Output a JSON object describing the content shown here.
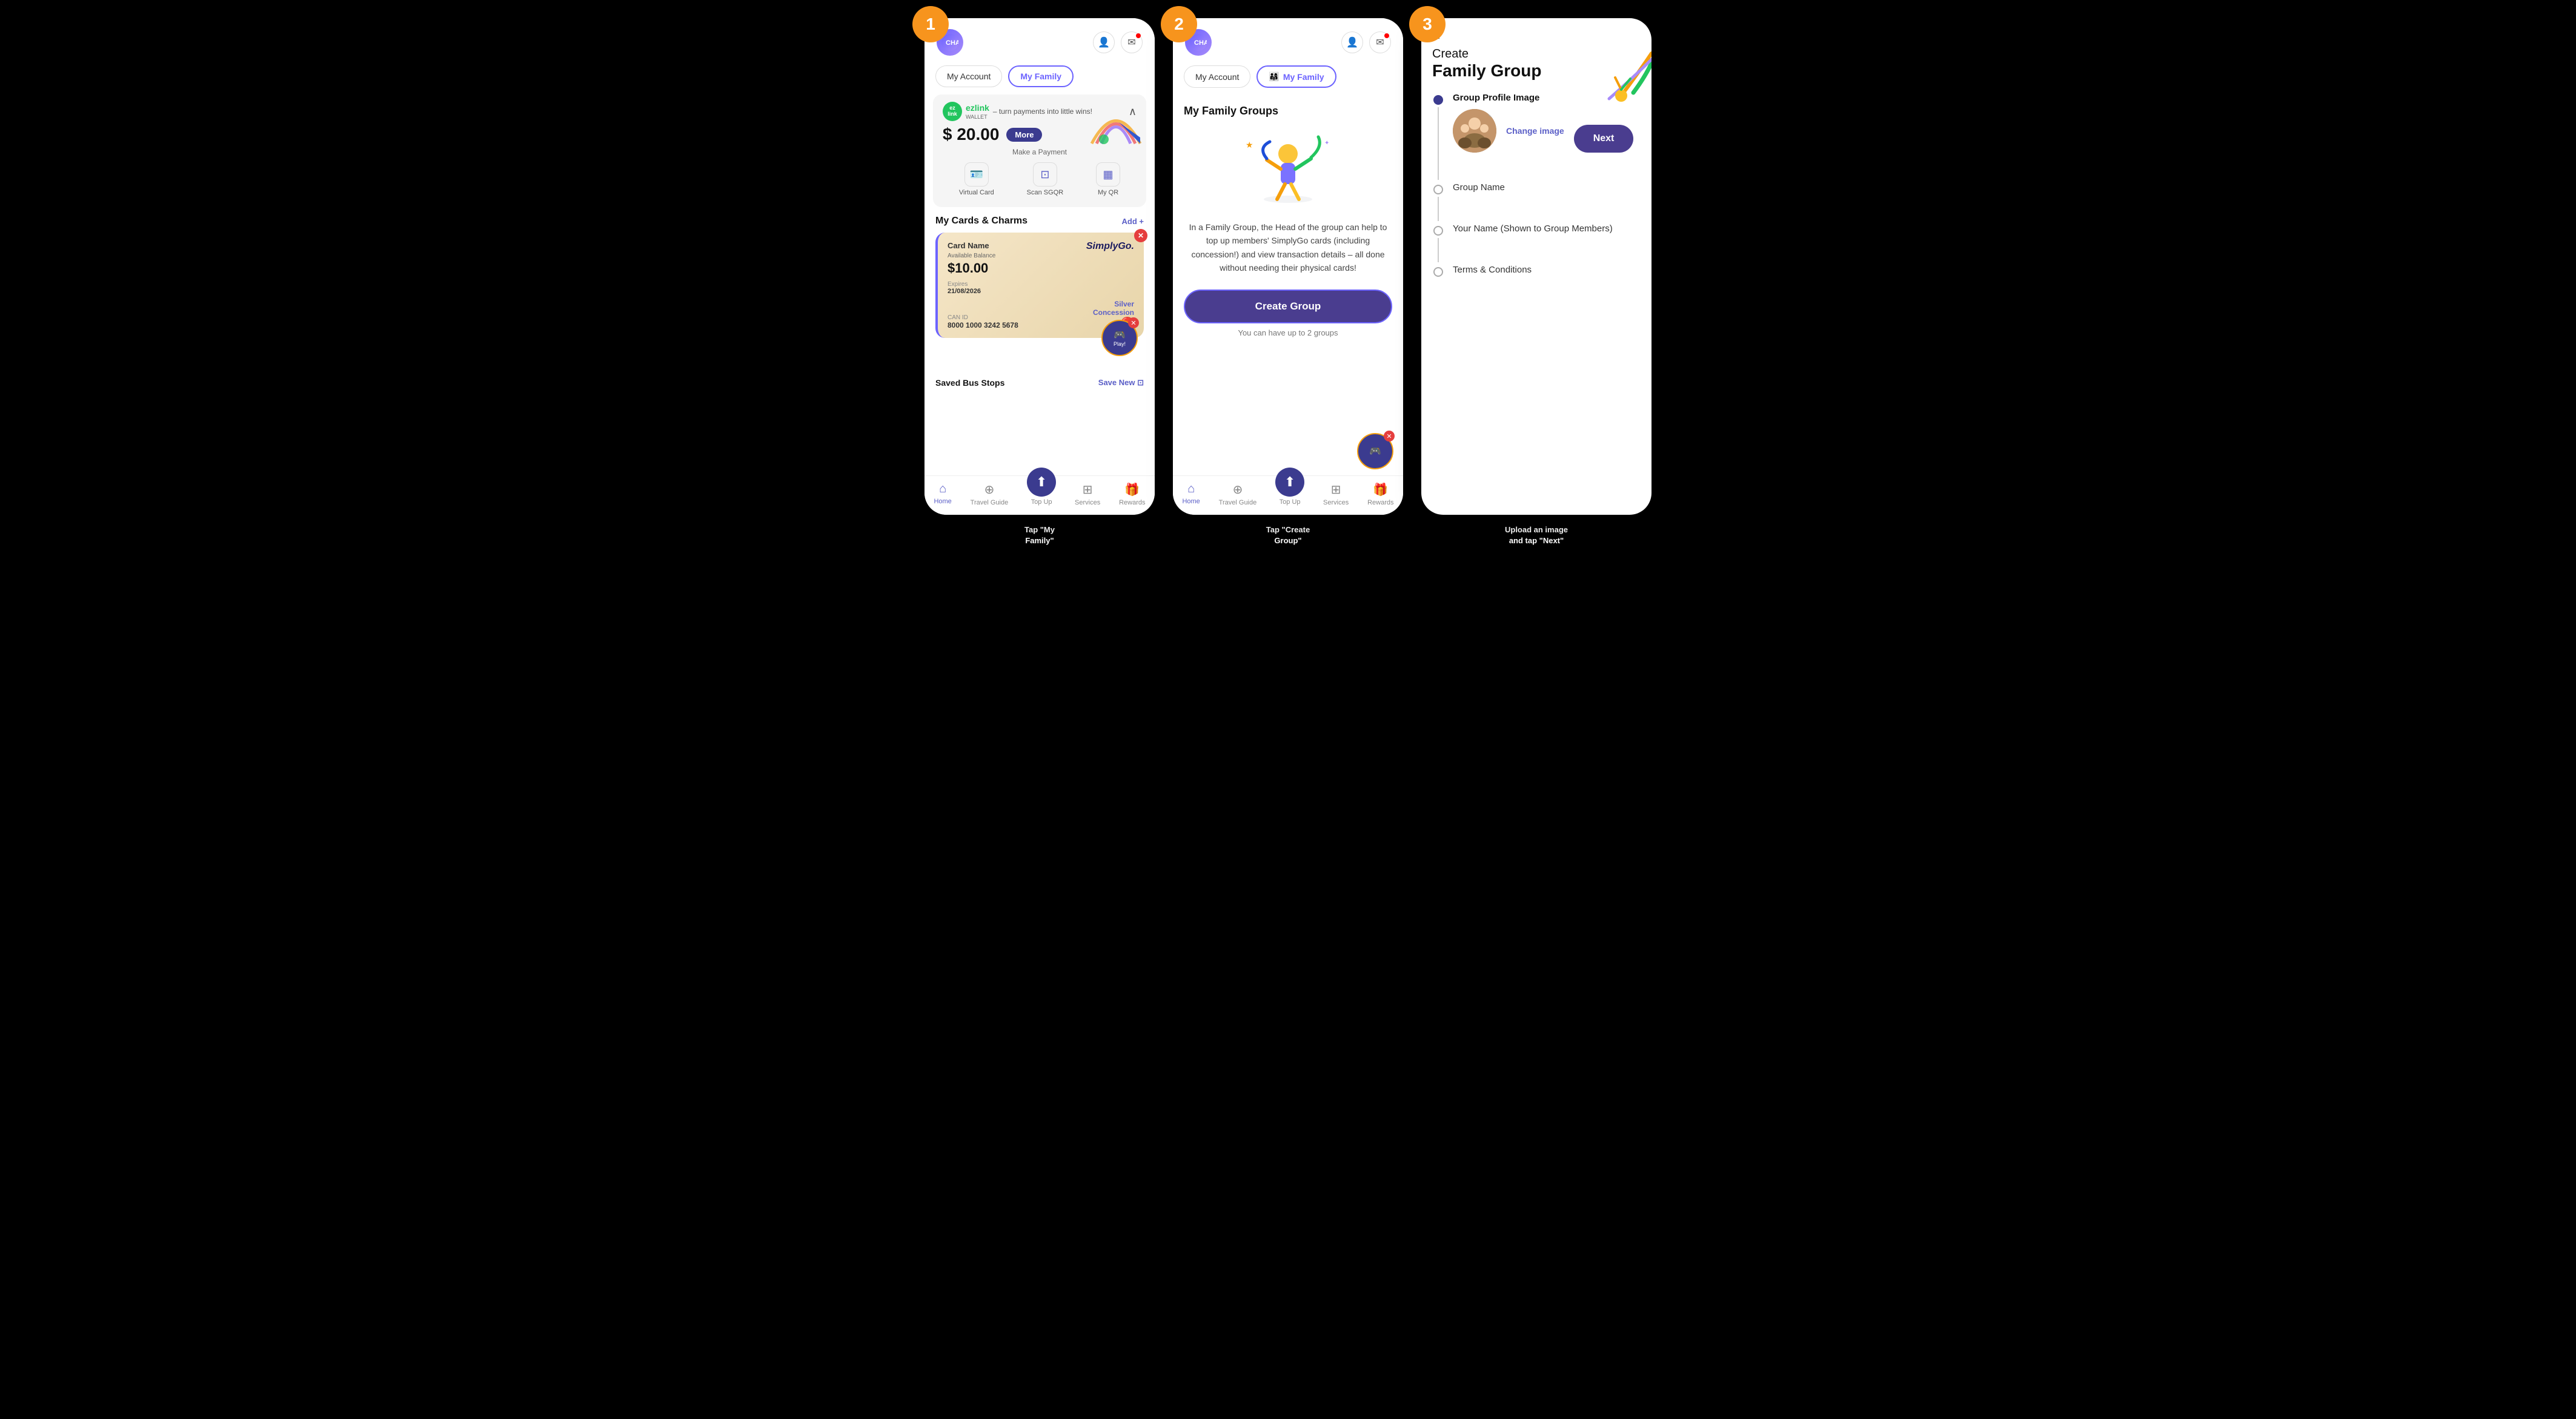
{
  "screen1": {
    "step": "1",
    "logo_text": "CHA",
    "tab_my_account": "My Account",
    "tab_my_family": "My Family",
    "ezlink_name": "ezlink",
    "ezlink_wallet": "WALLET",
    "ezlink_tagline": "– turn payments into little wins!",
    "balance": "$ 20.00",
    "more_label": "More",
    "make_payment": "Make a Payment",
    "virtual_card": "Virtual Card",
    "scan_sgqr": "Scan SGQR",
    "my_qr": "My QR",
    "cards_title": "My Cards & Charms",
    "add_label": "Add +",
    "card_name": "Card Name",
    "simplygo": "SimplyGo.",
    "avail_balance": "Available Balance",
    "card_balance": "$10.00",
    "expires_label": "Expires",
    "expires_date": "21/08/2026",
    "can_id": "CAN ID",
    "can_number": "8000 1000 3242 5678",
    "silver_label": "Silver",
    "concession_label": "Concession",
    "play_label": "Play!",
    "saved_bus": "Saved Bus Stops",
    "save_new": "Save New ⊡",
    "nav_home": "Home",
    "nav_travel": "Travel Guide",
    "nav_top_up": "Top Up",
    "nav_services": "Services",
    "nav_rewards": "Rewards",
    "annotation": "Tap \"My Family\""
  },
  "screen2": {
    "step": "2",
    "logo_text": "CHA",
    "tab_my_account": "My Account",
    "tab_my_family": "My Family",
    "family_groups_title": "My Family Groups",
    "family_desc": "In a Family Group, the Head of the group can help to top up members' SimplyGo cards (including concession!) and view transaction details – all done without needing their physical cards!",
    "create_group_btn": "Create Group",
    "max_groups": "You can have up to 2 groups",
    "nav_home": "Home",
    "nav_travel": "Travel Guide",
    "nav_top_up": "Top Up",
    "nav_services": "Services",
    "nav_rewards": "Rewards",
    "annotation": "Tap \"Create Group\""
  },
  "screen3": {
    "step": "3",
    "title_small": "Create",
    "title_big": "Family Group",
    "group_profile_label": "Group Profile Image",
    "change_image": "Change image",
    "next_btn": "Next",
    "group_name_label": "Group Name",
    "your_name_label": "Your Name (Shown to Group Members)",
    "terms_label": "Terms & Conditions",
    "annotation": "Upload an image and tap \"Next\""
  }
}
